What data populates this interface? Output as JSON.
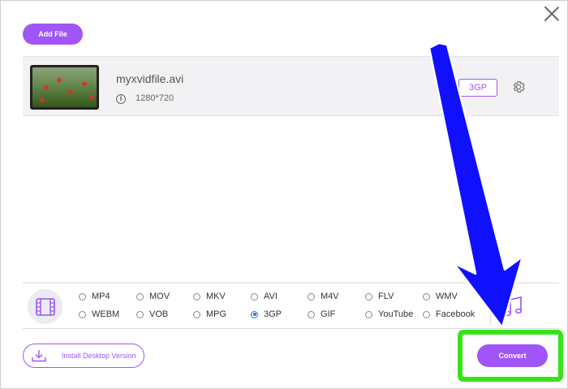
{
  "header": {
    "add_file_label": "Add File"
  },
  "file": {
    "name": "myxvidfile.avi",
    "resolution": "1280*720",
    "output_format": "3GP"
  },
  "formats": {
    "row1": [
      "MP4",
      "MOV",
      "MKV",
      "AVI",
      "M4V",
      "FLV",
      "WMV"
    ],
    "row2": [
      "WEBM",
      "VOB",
      "MPG",
      "3GP",
      "GIF",
      "YouTube",
      "Facebook"
    ],
    "selected": "3GP"
  },
  "footer": {
    "install_label": "Install Desktop Version",
    "convert_label": "Convert"
  },
  "colors": {
    "accent": "#a155f6",
    "highlight_box": "#37e317",
    "arrow": "#1010ff",
    "radio_selected": "#2f6ee6"
  },
  "icons": {
    "close": "close-icon",
    "info": "info-icon",
    "settings": "gear-icon",
    "video_tab": "film-icon",
    "audio_tab": "music-note-icon",
    "install": "download-icon"
  }
}
